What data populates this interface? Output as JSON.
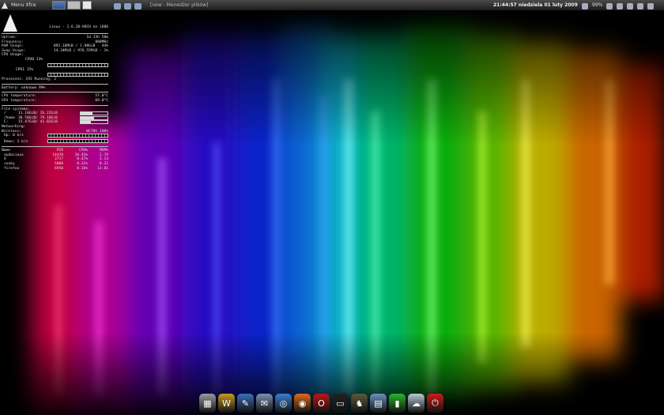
{
  "top_panel": {
    "menu_label": "Menu Xfce",
    "task_label": "[new - Menedżer plików]",
    "clock": "21:44:57  niedziela 01 luty 2009",
    "battery": "99%"
  },
  "conky": {
    "kernel": "Linux - 2.6.28-ARCH on i686",
    "stats": [
      {
        "label": "Uptime:",
        "value": "1d 13h 58m"
      },
      {
        "label": "Frequency:",
        "value": "800MHz"
      },
      {
        "label": "RAM Usage:",
        "value": "892.16MiB / 1.98GiB - 44%"
      },
      {
        "label": "Swap Usage:",
        "value": "14.34MiB / 976.55MiB - 1%"
      }
    ],
    "cpu_usage_label": "CPU Usage:",
    "cpu0": "CPU0 13%",
    "cpu1": "CPU1 15%",
    "processes": "Processes: 192  Running: 2",
    "battery": "Battery: unknown 99%",
    "cpu_temp_label": "CPU temperature:",
    "cpu_temp": "57.0°C",
    "gpu_temp_label": "GPU temperature:",
    "gpu_temp": "69.0°C",
    "fs_label": "File systems:",
    "filesystems": [
      {
        "mount": "/",
        "usage": "11.18GiB/ 26.22GiB",
        "fill": 0.43
      },
      {
        "mount": "/home",
        "usage": "38.58GiB/ 79.18GiB",
        "fill": 0.49
      },
      {
        "mount": "C:",
        "usage": "15.47GiB/ 41.02GiB",
        "fill": 0.38
      }
    ],
    "networking_label": "Networking:",
    "wireless_label": "Wireless:",
    "wireless_value": "WC78h 100%",
    "up": "Up: 0 k/s",
    "down": "Down: 1 k/s",
    "proc_headers": [
      "Name",
      "PID",
      "CPU%",
      "MEM%"
    ],
    "processes_list": [
      [
        "audacious",
        "14439",
        "10.43%",
        "2.79"
      ],
      [
        "X",
        "3717",
        "0.47%",
        "3.13"
      ],
      [
        "conky",
        "5008",
        "0.32%",
        "0.21"
      ],
      [
        "firefox",
        "6950",
        "0.16%",
        "13.01"
      ]
    ]
  },
  "dock_icons": [
    {
      "name": "calculator-icon",
      "color": "#9a9a9a",
      "glyph": "▦"
    },
    {
      "name": "world-of-warcraft-icon",
      "color": "#c59a22",
      "glyph": "W"
    },
    {
      "name": "pencil-tools-icon",
      "color": "#3b6fb6",
      "glyph": "✎"
    },
    {
      "name": "text-editor-icon",
      "color": "#7d8fb0",
      "glyph": "✉"
    },
    {
      "name": "network-globe-icon",
      "color": "#3a7fd0",
      "glyph": "◎"
    },
    {
      "name": "firefox-icon",
      "color": "#e06a1a",
      "glyph": "◉"
    },
    {
      "name": "opera-icon",
      "color": "#c01515",
      "glyph": "O"
    },
    {
      "name": "terminal-icon",
      "color": "#222222",
      "glyph": "▭"
    },
    {
      "name": "game-character-icon",
      "color": "#5b5b3b",
      "glyph": "♞"
    },
    {
      "name": "file-manager-icon",
      "color": "#6b8fc0",
      "glyph": "▤"
    },
    {
      "name": "battery-icon",
      "color": "#2bb52b",
      "glyph": "▮"
    },
    {
      "name": "weather-icon",
      "color": "#b8c8d8",
      "glyph": "☁"
    },
    {
      "name": "power-icon",
      "color": "#d01a1a",
      "glyph": "⏻"
    }
  ]
}
